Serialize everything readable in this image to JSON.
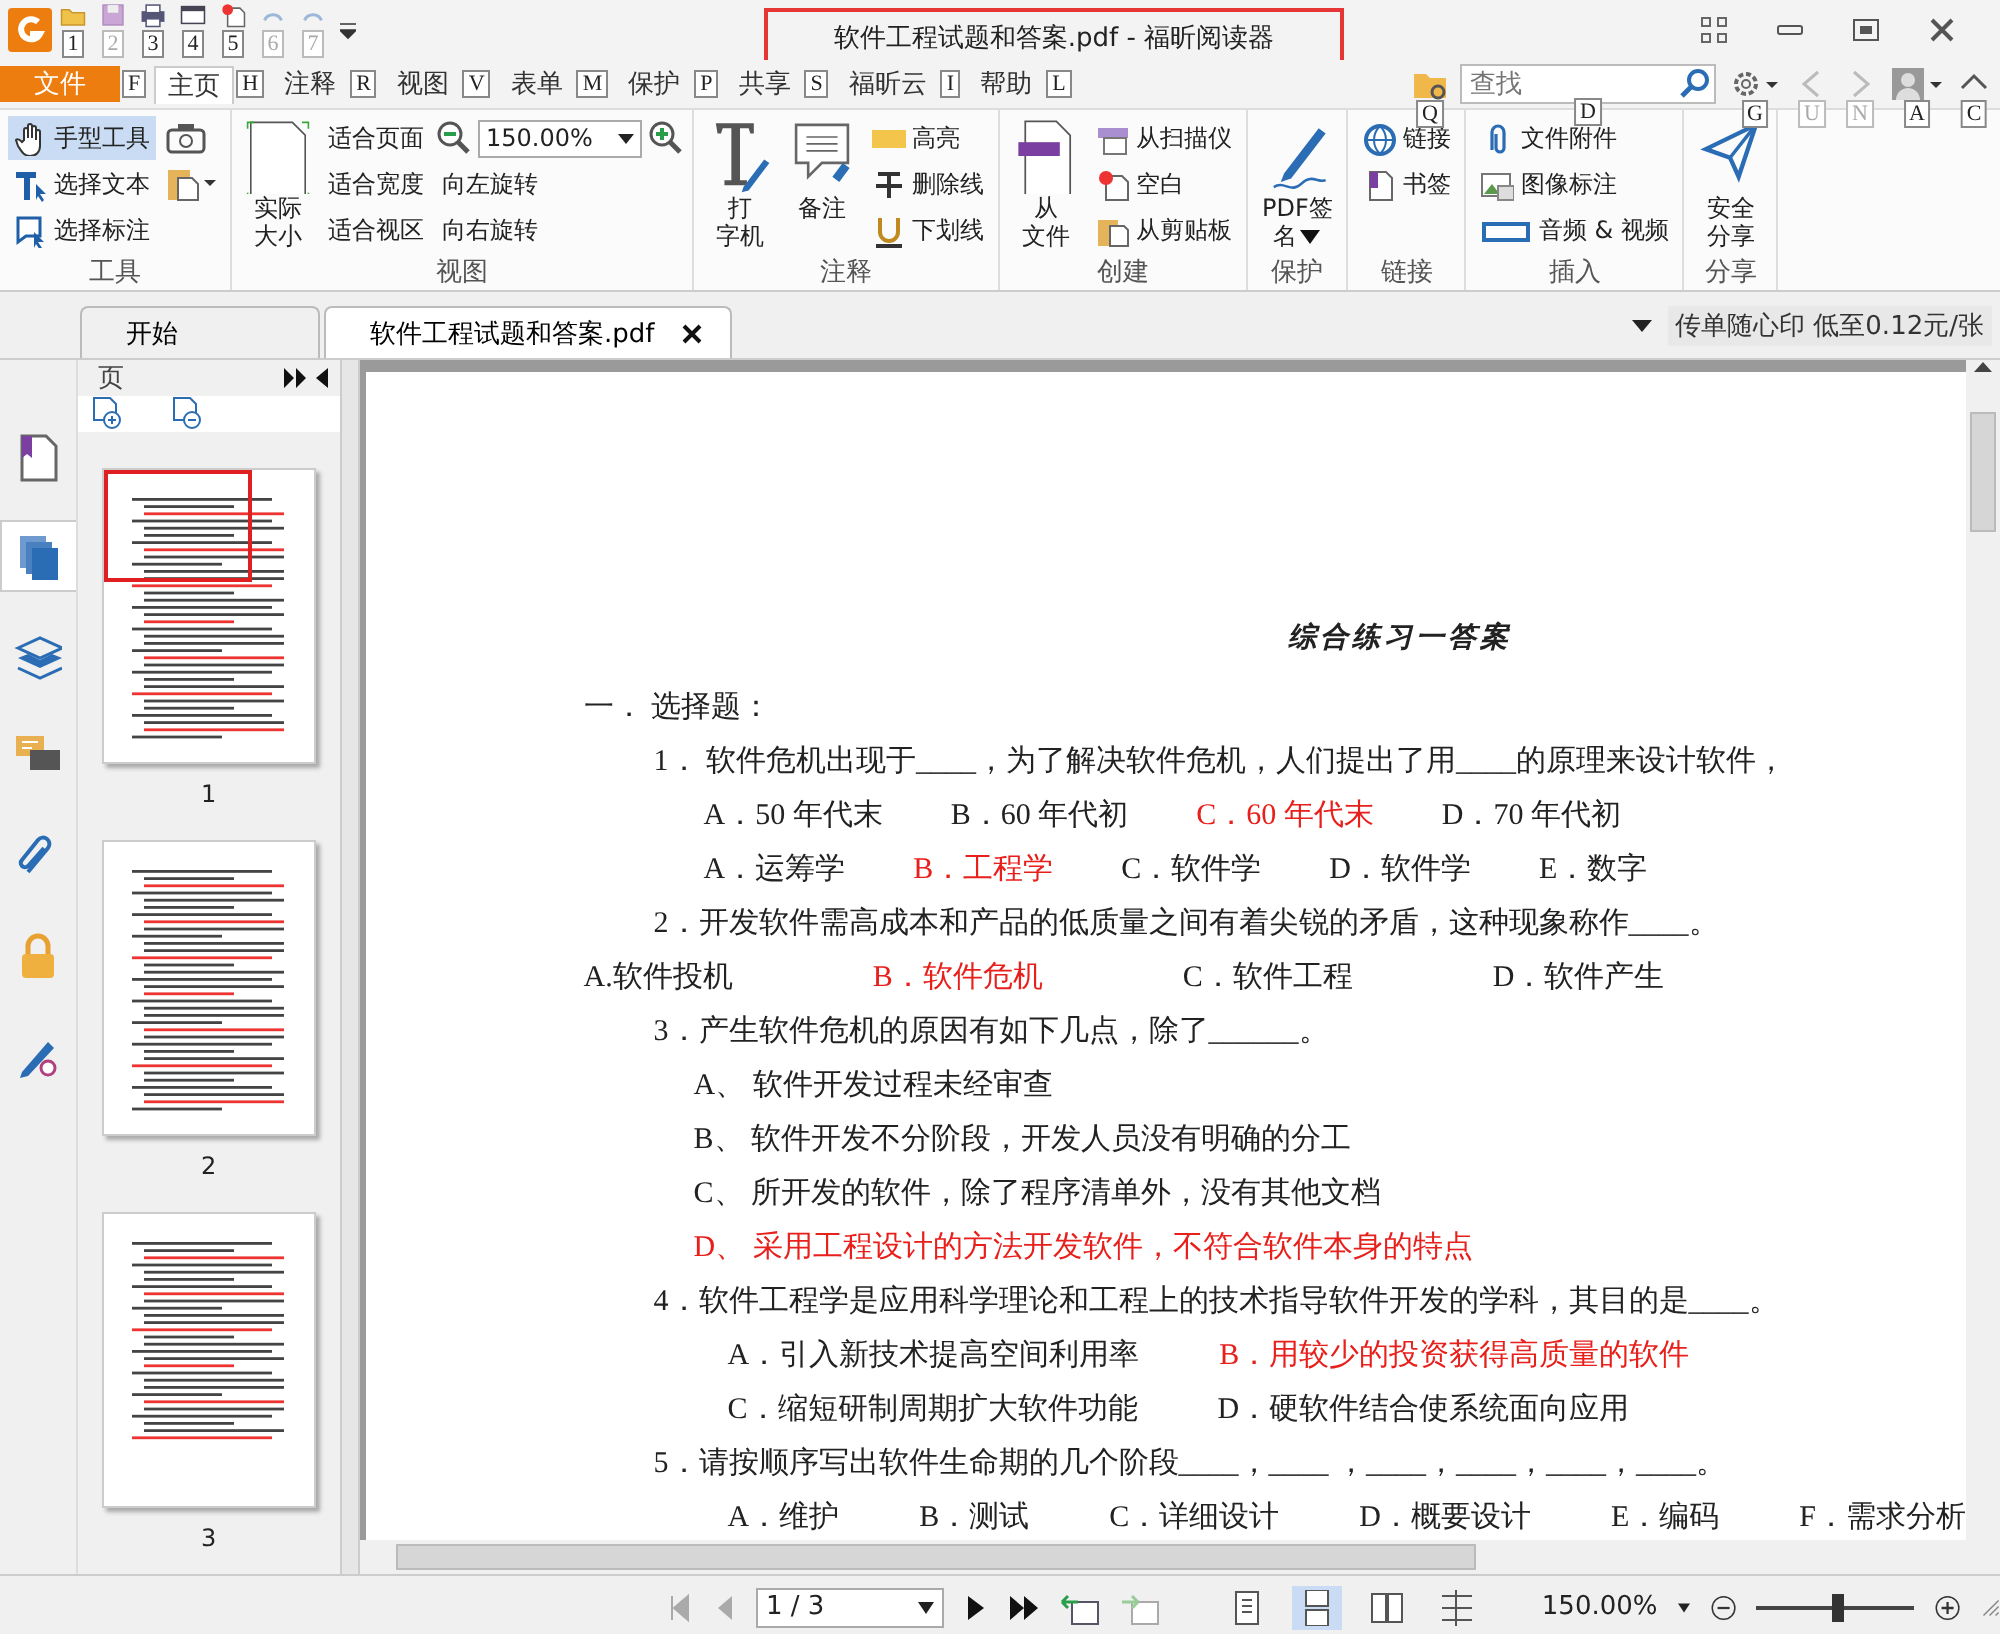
{
  "title_bar": {
    "title": "软件工程试题和答案.pdf - 福昕阅读器",
    "quick_access": [
      {
        "keytip": "1",
        "disabled": false
      },
      {
        "keytip": "2",
        "disabled": true
      },
      {
        "keytip": "3",
        "disabled": false
      },
      {
        "keytip": "4",
        "disabled": false
      },
      {
        "keytip": "5",
        "disabled": false
      },
      {
        "keytip": "6",
        "disabled": true
      },
      {
        "keytip": "7",
        "disabled": true
      }
    ]
  },
  "menu_tabs": [
    {
      "label": "文件",
      "keytip": "F",
      "selected": false,
      "kind": "file"
    },
    {
      "label": "主页",
      "keytip": "H",
      "selected": true,
      "kind": "tab"
    },
    {
      "label": "注释",
      "keytip": "R",
      "selected": false,
      "kind": "tab"
    },
    {
      "label": "视图",
      "keytip": "V",
      "selected": false,
      "kind": "tab"
    },
    {
      "label": "表单",
      "keytip": "M",
      "selected": false,
      "kind": "tab"
    },
    {
      "label": "保护",
      "keytip": "P",
      "selected": false,
      "kind": "tab"
    },
    {
      "label": "共享",
      "keytip": "S",
      "selected": false,
      "kind": "tab"
    },
    {
      "label": "福昕云",
      "keytip": "I",
      "selected": false,
      "kind": "tab"
    },
    {
      "label": "帮助",
      "keytip": "L",
      "selected": false,
      "kind": "tab"
    }
  ],
  "toolbar_right": {
    "search": {
      "placeholder": "查找",
      "keytip": "D"
    },
    "buttons": [
      {
        "kind": "folder",
        "keytip": "Q",
        "disabled": false
      },
      {
        "kind": "search-field"
      },
      {
        "kind": "gear",
        "keytip": "G",
        "disabled": false
      },
      {
        "kind": "back",
        "keytip": "U",
        "disabled": true
      },
      {
        "kind": "forward",
        "keytip": "N",
        "disabled": true
      },
      {
        "kind": "avatar",
        "keytip": "A",
        "disabled": false
      },
      {
        "kind": "collapse",
        "keytip": "C",
        "disabled": false
      }
    ]
  },
  "ribbon": [
    {
      "label": "工具",
      "columns": [
        [
          {
            "kind": "small",
            "label": "手型工具",
            "selected": true
          },
          {
            "kind": "small",
            "label": "选择文本",
            "selected": false
          },
          {
            "kind": "small",
            "label": "选择标注",
            "selected": false
          }
        ],
        [
          {
            "kind": "icon"
          },
          {
            "kind": "icon"
          }
        ]
      ]
    },
    {
      "label": "视图",
      "columns": [
        [
          {
            "kind": "large",
            "lines": [
              "实际",
              "大小"
            ]
          }
        ],
        [
          {
            "kind": "small",
            "label": "适合页面"
          },
          {
            "kind": "small",
            "label": "适合宽度"
          },
          {
            "kind": "small",
            "label": "适合视区"
          }
        ],
        [
          {
            "kind": "zoom",
            "value": "150.00%"
          },
          {
            "kind": "small",
            "label": "向左旋转"
          },
          {
            "kind": "small",
            "label": "向右旋转"
          }
        ]
      ]
    },
    {
      "label": "注释",
      "columns": [
        [
          {
            "kind": "large",
            "lines": [
              "打",
              "字机"
            ]
          }
        ],
        [
          {
            "kind": "large",
            "lines": [
              "备注"
            ]
          }
        ],
        [
          {
            "kind": "small",
            "label": "高亮"
          },
          {
            "kind": "small",
            "label": "删除线"
          },
          {
            "kind": "small",
            "label": "下划线"
          }
        ]
      ]
    },
    {
      "label": "创建",
      "columns": [
        [
          {
            "kind": "large",
            "lines": [
              "从",
              "文件"
            ]
          }
        ],
        [
          {
            "kind": "small",
            "label": "从扫描仪"
          },
          {
            "kind": "small",
            "label": "空白"
          },
          {
            "kind": "small",
            "label": "从剪贴板"
          }
        ]
      ]
    },
    {
      "label": "保护",
      "columns": [
        [
          {
            "kind": "large",
            "lines": [
              "PDF签",
              "名"
            ],
            "dropdown": true
          }
        ]
      ]
    },
    {
      "label": "链接",
      "columns": [
        [
          {
            "kind": "small",
            "label": "链接"
          },
          {
            "kind": "small",
            "label": "书签"
          }
        ]
      ]
    },
    {
      "label": "插入",
      "columns": [
        [
          {
            "kind": "small",
            "label": "文件附件"
          },
          {
            "kind": "small",
            "label": "图像标注"
          },
          {
            "kind": "small",
            "label": "音频 & 视频"
          }
        ]
      ]
    },
    {
      "label": "分享",
      "columns": [
        [
          {
            "kind": "large",
            "lines": [
              "安全",
              "分享"
            ]
          }
        ]
      ]
    }
  ],
  "doc_tabs": [
    {
      "label": "开始",
      "selected": false,
      "closable": false
    },
    {
      "label": "软件工程试题和答案.pdf",
      "selected": true,
      "closable": true
    }
  ],
  "ad": "传单随心印 低至0.12元/张",
  "side_strip": [
    {
      "selected": false
    },
    {
      "selected": true
    },
    {
      "selected": false
    },
    {
      "selected": false
    },
    {
      "selected": false
    },
    {
      "selected": false
    },
    {
      "selected": false
    }
  ],
  "pages_panel": {
    "title": "页",
    "thumbnails": [
      {
        "label": "1",
        "viewport": true
      },
      {
        "label": "2",
        "viewport": false
      },
      {
        "label": "3",
        "viewport": false
      }
    ]
  },
  "document": {
    "title": "综合练习一答案",
    "lines": [
      {
        "kind": "flush",
        "parts": [
          {
            "text": "一．  选择题：",
            "answer": false
          }
        ]
      },
      {
        "kind": "question",
        "parts": [
          {
            "text": "1．   软件危机出现于____，为了解决软件危机，人们提出了用____的原理来设计软件，",
            "answer": false
          }
        ]
      },
      {
        "kind": "option",
        "parts": [
          {
            "text": "A．50 年代末",
            "answer": false
          },
          {
            "text": "B．60 年代初",
            "answer": false
          },
          {
            "text": "C．60 年代末",
            "answer": true
          },
          {
            "text": "D．70 年代初",
            "answer": false
          }
        ]
      },
      {
        "kind": "option",
        "parts": [
          {
            "text": "A．运筹学",
            "answer": false
          },
          {
            "text": "B．工程学",
            "answer": true
          },
          {
            "text": "C．软件学",
            "answer": false
          },
          {
            "text": "D．软件学",
            "answer": false
          },
          {
            "text": "E．数字",
            "answer": false
          }
        ]
      },
      {
        "kind": "question",
        "parts": [
          {
            "text": "2．开发软件需高成本和产品的低质量之间有着尖锐的矛盾，这种现象称作____。",
            "answer": false
          }
        ]
      },
      {
        "kind": "flush",
        "parts": [
          {
            "text": "A.软件投机",
            "answer": false
          },
          {
            "text": "B．软件危机",
            "answer": true
          },
          {
            "text": "C．软件工程",
            "answer": false
          },
          {
            "text": "D．软件产生",
            "answer": false
          }
        ]
      },
      {
        "kind": "question",
        "parts": [
          {
            "text": "3．产生软件危机的原因有如下几点，除了______。",
            "answer": false
          }
        ]
      },
      {
        "kind": "sub",
        "parts": [
          {
            "text": "A、 软件开发过程未经审查",
            "answer": false
          }
        ]
      },
      {
        "kind": "sub",
        "parts": [
          {
            "text": "B、 软件开发不分阶段，开发人员没有明确的分工",
            "answer": false
          }
        ]
      },
      {
        "kind": "sub",
        "parts": [
          {
            "text": "C、 所开发的软件，除了程序清单外，没有其他文档",
            "answer": false
          }
        ]
      },
      {
        "kind": "sub",
        "parts": [
          {
            "text": "D、 采用工程设计的方法开发软件，不符合软件本身的特点",
            "answer": true
          }
        ]
      },
      {
        "kind": "question",
        "parts": [
          {
            "text": "4．软件工程学是应用科学理论和工程上的技术指导软件开发的学科，其目的是____。",
            "answer": false
          }
        ]
      },
      {
        "kind": "option2",
        "parts": [
          {
            "text": "A．引入新技术提高空间利用率",
            "answer": false
          },
          {
            "text": "B．用较少的投资获得高质量的软件",
            "answer": true
          }
        ]
      },
      {
        "kind": "option2",
        "parts": [
          {
            "text": "C．缩短研制周期扩大软件功能",
            "answer": false
          },
          {
            "text": "D．硬软件结合使系统面向应用",
            "answer": false
          }
        ]
      },
      {
        "kind": "question",
        "parts": [
          {
            "text": "5．请按顺序写出软件生命期的几个阶段____，____ ，____，____，____，____。",
            "answer": false
          }
        ]
      },
      {
        "kind": "option2",
        "parts": [
          {
            "text": "A．维护",
            "answer": false
          },
          {
            "text": "B．测试",
            "answer": false
          },
          {
            "text": "C．详细设计",
            "answer": false
          },
          {
            "text": "D．概要设计",
            "answer": false
          },
          {
            "text": "E．编码",
            "answer": false
          },
          {
            "text": "F．需求分析",
            "answer": false
          }
        ]
      }
    ]
  },
  "status_bar": {
    "nav": [
      {
        "kind": "first",
        "disabled": true
      },
      {
        "kind": "prev",
        "disabled": true
      },
      {
        "kind": "page-field",
        "value": "1 / 3"
      },
      {
        "kind": "next",
        "disabled": false
      },
      {
        "kind": "last",
        "disabled": false
      },
      {
        "kind": "prev-view",
        "disabled": false
      },
      {
        "kind": "next-view",
        "disabled": true
      }
    ],
    "views": [
      {
        "selected": false
      },
      {
        "selected": true
      },
      {
        "selected": false
      },
      {
        "selected": false
      }
    ],
    "zoom": "150.00%",
    "zoom_slider": {
      "level": 0.52
    }
  }
}
